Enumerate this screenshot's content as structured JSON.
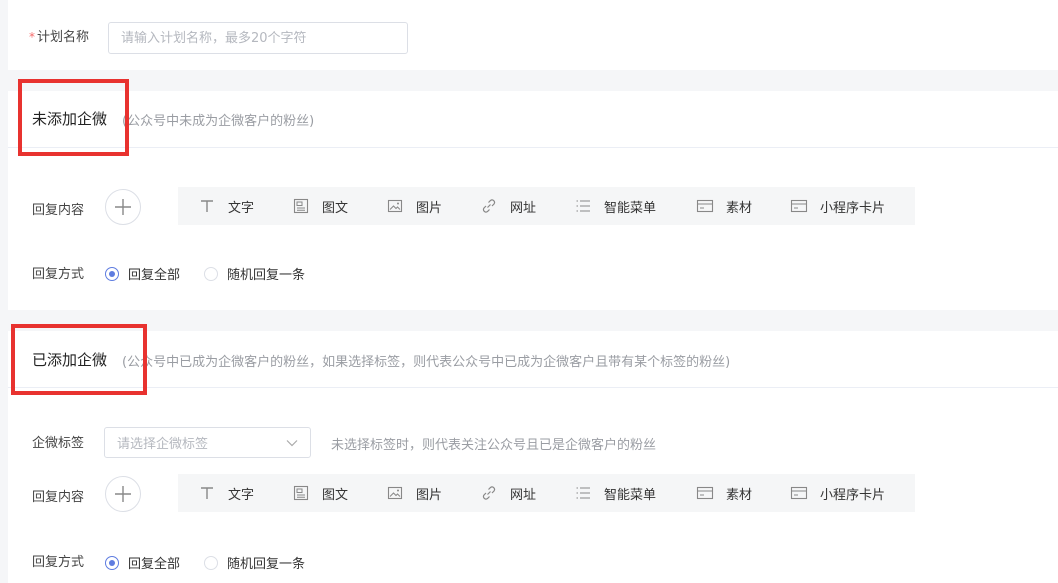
{
  "plan": {
    "required_mark": "*",
    "name_label": "计划名称",
    "name_placeholder": "请输入计划名称，最多20个字符",
    "name_value": ""
  },
  "section_not_added": {
    "title": "未添加企微",
    "hint": "(公众号中未成为企微客户的粉丝)",
    "reply_content_label": "回复内容",
    "reply_mode_label": "回复方式",
    "reply_options": [
      {
        "label": "回复全部",
        "checked": true
      },
      {
        "label": "随机回复一条",
        "checked": false
      }
    ]
  },
  "section_added": {
    "title": "已添加企微",
    "hint": "(公众号中已成为企微客户的粉丝，如果选择标签，则代表公众号中已成为企微客户且带有某个标签的粉丝)",
    "tag_label": "企微标签",
    "tag_placeholder": "请选择企微标签",
    "tag_hint": "未选择标签时，则代表关注公众号且已是企微客户的粉丝",
    "reply_content_label": "回复内容",
    "reply_mode_label": "回复方式",
    "reply_options": [
      {
        "label": "回复全部",
        "checked": true
      },
      {
        "label": "随机回复一条",
        "checked": false
      }
    ]
  },
  "toolbar": {
    "items": [
      {
        "label": "文字",
        "icon": "text-icon"
      },
      {
        "label": "图文",
        "icon": "article-icon"
      },
      {
        "label": "图片",
        "icon": "image-icon"
      },
      {
        "label": "网址",
        "icon": "link-icon"
      },
      {
        "label": "智能菜单",
        "icon": "menu-list-icon"
      },
      {
        "label": "素材",
        "icon": "material-icon"
      },
      {
        "label": "小程序卡片",
        "icon": "mini-program-card-icon"
      }
    ]
  },
  "colors": {
    "accent": "#5e7ce0",
    "highlight_box": "#e8322f",
    "required": "#f56c6c",
    "hint": "#9a9da3",
    "toolbar_bg": "#f5f6f7"
  }
}
